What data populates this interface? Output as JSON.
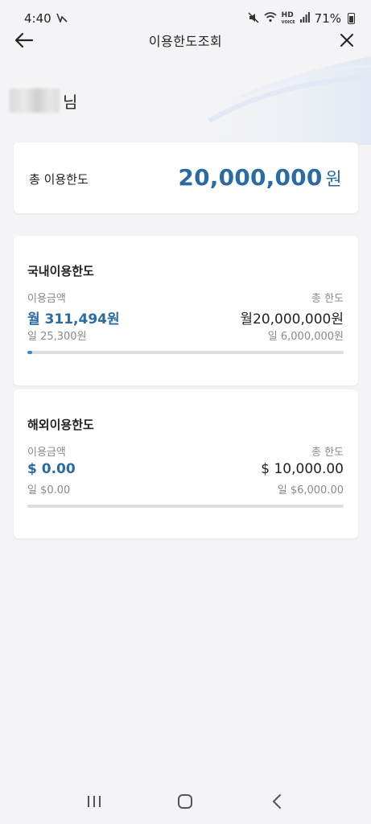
{
  "status_bar": {
    "time": "4:40",
    "battery": "71%",
    "icons": [
      "notification-icon",
      "mute-icon",
      "wifi-icon",
      "hd-voice-icon",
      "signal-icon",
      "battery-icon"
    ]
  },
  "app_bar": {
    "title": "이용한도조회",
    "back_icon": "arrow-left-icon",
    "close_icon": "close-icon"
  },
  "user": {
    "name_suffix": "님"
  },
  "total_limit": {
    "label": "총 이용한도",
    "value": "20,000,000",
    "unit": "원"
  },
  "domestic": {
    "title": "국내이용한도",
    "used_label": "이용금액",
    "limit_label": "총 한도",
    "used_monthly": "월 311,494원",
    "used_daily": "일 25,300원",
    "limit_monthly": "월20,000,000원",
    "limit_daily": "일 6,000,000원",
    "progress_fraction": 0.0156
  },
  "overseas": {
    "title": "해외이용한도",
    "used_label": "이용금액",
    "limit_label": "총 한도",
    "used_monthly": "$ 0.00",
    "used_daily": "일 $0.00",
    "limit_monthly": "$ 10,000.00",
    "limit_daily": "일 $6,000.00",
    "progress_fraction": 0
  },
  "nav": {
    "recent_icon": "recent-apps-icon",
    "home_icon": "home-icon",
    "back_icon": "back-icon"
  },
  "colors": {
    "accent": "#2a6ba3",
    "progress": "#2a8fd8",
    "track": "#dedede",
    "background": "#f4f4f6"
  }
}
